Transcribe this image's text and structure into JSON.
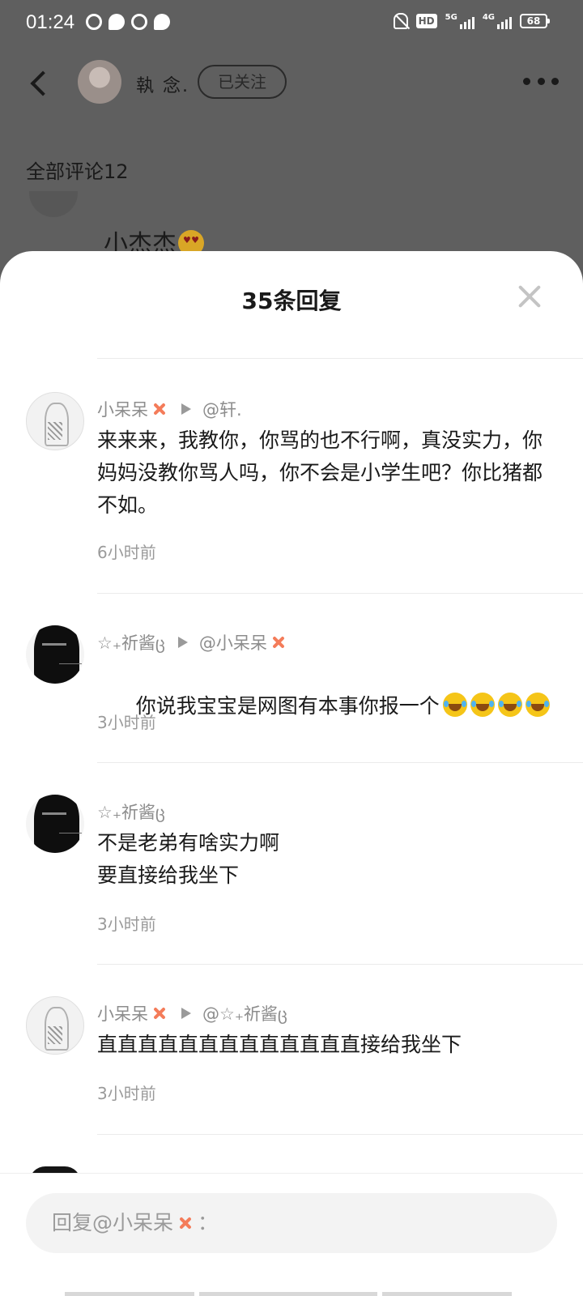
{
  "status_bar": {
    "time": "01:24",
    "hd": "HD",
    "net_5g": "5G",
    "net_4g": "4G",
    "battery": "68"
  },
  "background_page": {
    "author_name": "執 念.",
    "follow_label": "已关注",
    "all_comments_label": "全部评论12",
    "peek_comment_text": "小杰杰"
  },
  "sheet": {
    "title": "35条回复",
    "replies": [
      {
        "username": "小呆呆",
        "username_emoji": "anger-icon",
        "reply_to": "@轩.",
        "content": "来来来，我教你，你骂的也不行啊，真没实力，你妈妈没教你骂人吗，你不会是小学生吧？你比猪都不如。",
        "time": "6小时前"
      },
      {
        "username": "☆₊祈酱ც",
        "reply_to": "@小呆呆",
        "reply_to_emoji": "anger-icon",
        "content": "你说我宝宝是网图有本事你报一个",
        "content_emoji": [
          "laugh-cry-icon",
          "laugh-cry-icon",
          "laugh-cry-icon",
          "laugh-cry-icon"
        ],
        "time": "3小时前"
      },
      {
        "username": "☆₊祈酱ც",
        "content": "不是老弟有啥实力啊\n要直接给我坐下",
        "time": "3小时前"
      },
      {
        "username": "小呆呆",
        "username_emoji": "anger-icon",
        "reply_to": "@☆₊祈酱ც",
        "content": "直直直直直直直直直直直直直接给我坐下",
        "time": "3小时前"
      }
    ]
  },
  "input": {
    "placeholder_prefix": "回复@小呆呆",
    "placeholder_suffix": "："
  }
}
